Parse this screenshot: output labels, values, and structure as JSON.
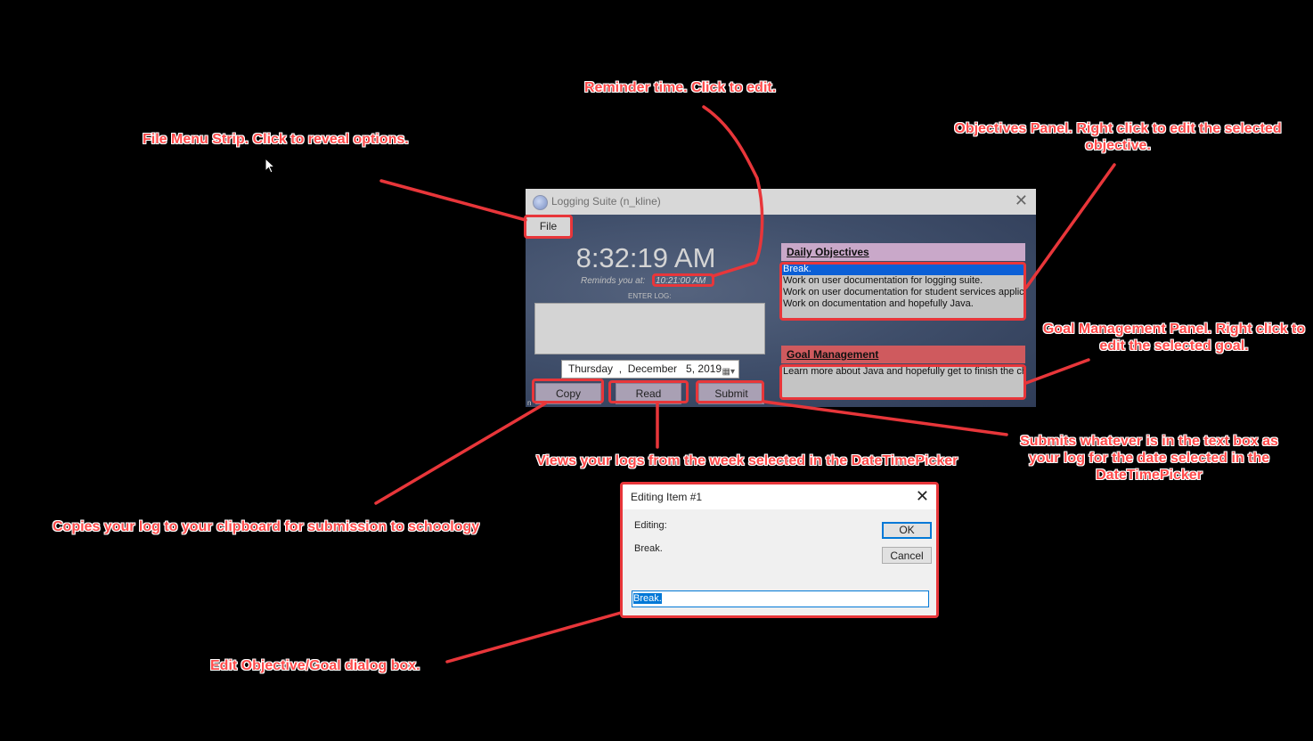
{
  "annotations": {
    "reminder": "Reminder time. Click to edit.",
    "file_menu": "File Menu Strip. Click to reveal options.",
    "objectives": "Objectives Panel. Right click to edit the selected objective.",
    "goal": "Goal Management Panel. Right click to edit the selected goal.",
    "read": "Views your logs from the week selected in the DateTimePicker",
    "submit": "Submits whatever is in the text box as your log for the date selected in the DateTimePicker",
    "copy": "Copies your log to your clipboard for submission to schoology",
    "dialog": "Edit Objective/Goal dialog box."
  },
  "window": {
    "title": "Logging Suite (n_kline)",
    "menu_file": "File",
    "clock": "8:32:19 AM",
    "reminds_label": "Reminds you at:",
    "reminder_time": "10:21:00 AM",
    "enter_log_label": "ENTER LOG:",
    "date_value": "Thursday  ,  December   5, 2019",
    "buttons": {
      "copy": "Copy",
      "read": "Read",
      "submit": "Submit"
    },
    "objectives": {
      "header": "Daily Objectives",
      "items": [
        "Break.",
        "Work on user documentation for logging suite.",
        "Work on user documentation for student services application.",
        "Work on documentation and hopefully Java."
      ],
      "selected_index": 0
    },
    "goals": {
      "header": "Goal Management",
      "items": [
        "Learn more about Java and hopefully get to finish the chapter."
      ]
    }
  },
  "dialog": {
    "title": "Editing Item #1",
    "editing_label": "Editing:",
    "editing_value": "Break.",
    "ok": "OK",
    "cancel": "Cancel",
    "input_value": "Break."
  },
  "colors": {
    "annotation": "#ff4a4a",
    "highlight": "#e8363a",
    "objectives_header": "#c9a8c9",
    "goal_header": "#cf5a5e",
    "selection": "#0b5fd6"
  }
}
